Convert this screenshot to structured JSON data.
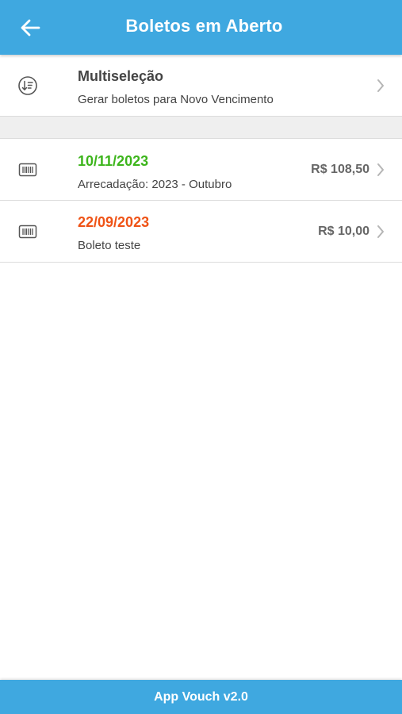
{
  "header": {
    "title": "Boletos em Aberto",
    "back_icon": "arrow-left-icon",
    "background": "#3fa8e0"
  },
  "multiselect": {
    "title": "Multiseleção",
    "subtitle": "Gerar boletos para Novo Vencimento",
    "icon": "sort-list-circle-icon"
  },
  "boletos": [
    {
      "due_date": "10/11/2023",
      "description": "Arrecadação: 2023 - Outubro",
      "amount": "R$ 108,50",
      "date_color": "#3db51c",
      "icon": "barcode-icon"
    },
    {
      "due_date": "22/09/2023",
      "description": "Boleto teste",
      "amount": "R$ 10,00",
      "date_color": "#ef5316",
      "icon": "barcode-icon"
    }
  ],
  "footer": {
    "label": "App Vouch v2.0"
  }
}
